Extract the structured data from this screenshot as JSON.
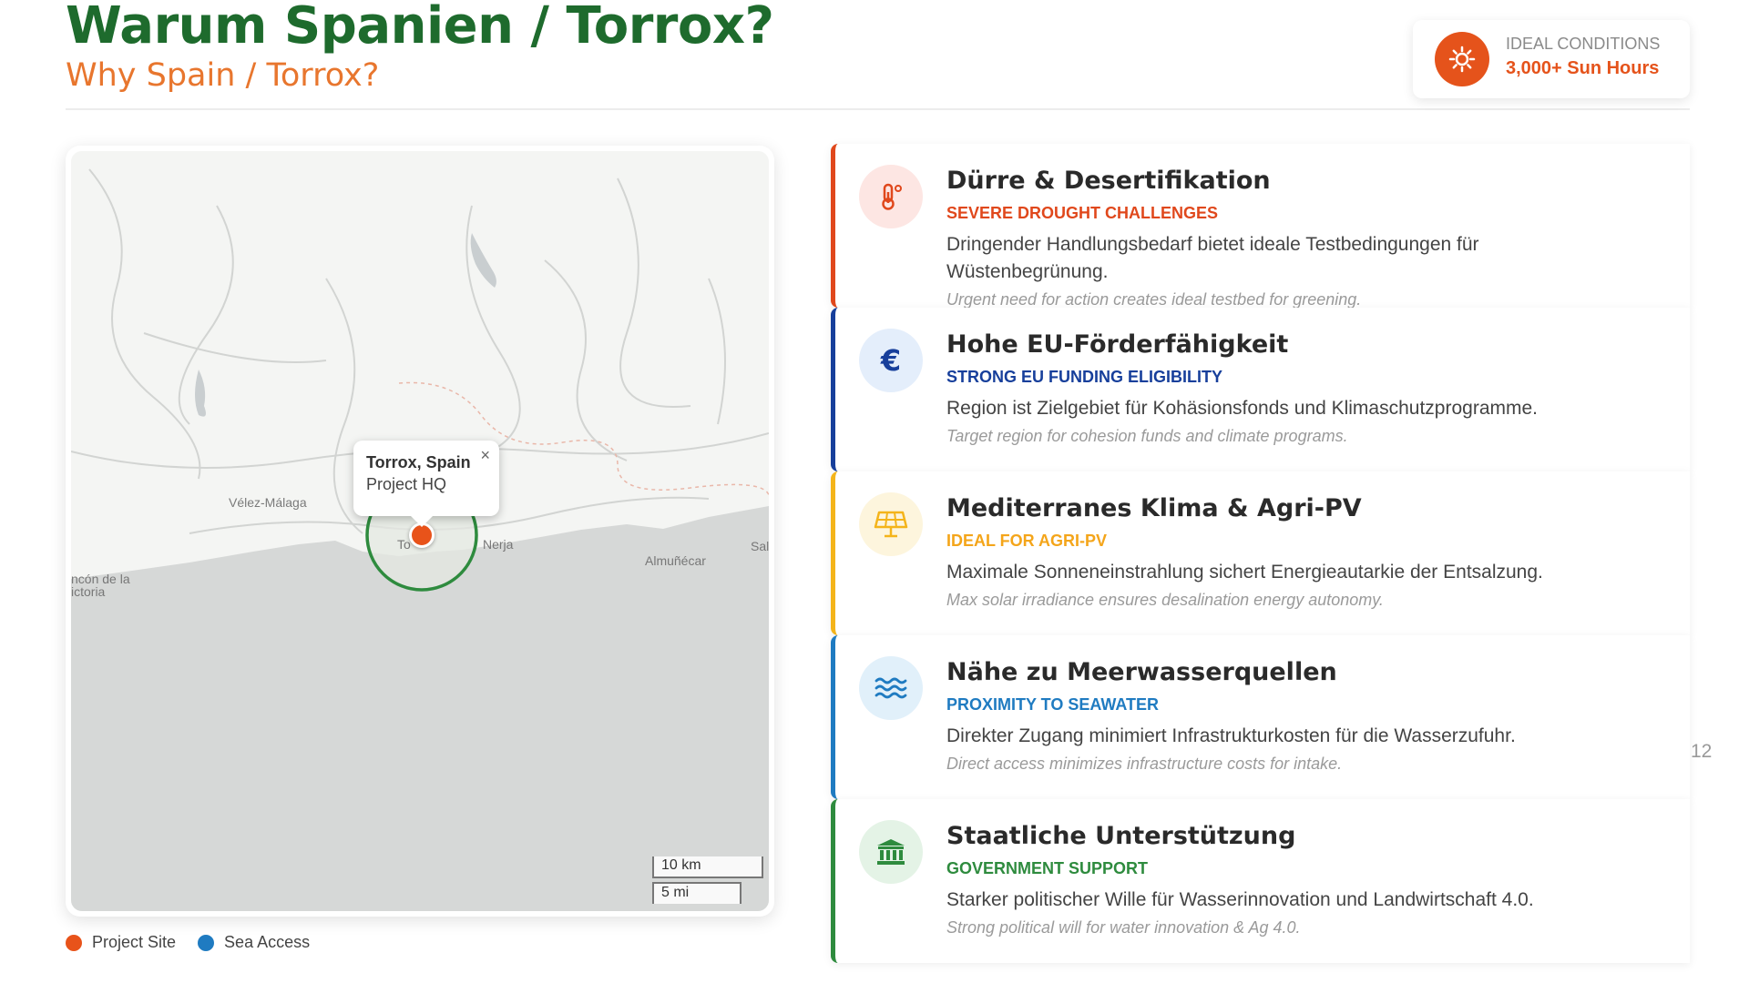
{
  "header": {
    "title": "Warum Spanien / Torrox?",
    "subtitle": "Why Spain / Torrox?"
  },
  "badge": {
    "icon": "sun-icon",
    "label": "IDEAL CONDITIONS",
    "value": "3,000+ Sun Hours"
  },
  "map": {
    "places": {
      "velez": "Vélez-Málaga",
      "nerja": "Nerja",
      "almunecar": "Almuñécar",
      "sal": "Sal",
      "rincon_1": "ncón de la",
      "rincon_2": "ictoria",
      "torrox_partial": "To"
    },
    "popup": {
      "title": "Torrox, Spain",
      "subtitle": "Project HQ",
      "close": "×"
    },
    "scale": {
      "km": "10 km",
      "mi": "5 mi"
    }
  },
  "legend": [
    {
      "label": "Project Site",
      "color": "#e8531a"
    },
    {
      "label": "Sea Access",
      "color": "#1f7bc1"
    }
  ],
  "cards": [
    {
      "title": "Dürre & Desertifikation",
      "subtitle": "SEVERE DROUGHT CHALLENGES",
      "desc": "Dringender Handlungsbedarf bietet ideale Testbedingungen für Wüstenbegrünung.",
      "en": "Urgent need for action creates ideal testbed for greening.",
      "icon": "thermometer-icon",
      "color": "#e0481c",
      "bg": "#fde6e3"
    },
    {
      "title": "Hohe EU-Förderfähigkeit",
      "subtitle": "STRONG EU FUNDING ELIGIBILITY",
      "desc": "Region ist Zielgebiet für Kohäsionsfonds und Klimaschutzprogramme.",
      "en": "Target region for cohesion funds and climate programs.",
      "icon": "euro-icon",
      "color": "#173f9b",
      "bg": "#e4eefb"
    },
    {
      "title": "Mediterranes Klima & Agri-PV",
      "subtitle": "IDEAL FOR AGRI-PV",
      "desc": "Maximale Sonneneinstrahlung sichert Energieautarkie der Entsalzung.",
      "en": "Max solar irradiance ensures desalination energy autonomy.",
      "icon": "solar-panel-icon",
      "color": "#f4b41a",
      "bg": "#fdf5dd"
    },
    {
      "title": "Nähe zu Meerwasserquellen",
      "subtitle": "PROXIMITY TO SEAWATER",
      "desc": "Direkter Zugang minimiert Infrastrukturkosten für die Wasserzufuhr.",
      "en": "Direct access minimizes infrastructure costs for intake.",
      "icon": "water-waves-icon",
      "color": "#1f7bc1",
      "bg": "#e1f0fa"
    },
    {
      "title": "Staatliche Unterstützung",
      "subtitle": "GOVERNMENT SUPPORT",
      "desc": "Starker politischer Wille für Wasserinnovation und Landwirtschaft 4.0.",
      "en": "Strong political will for water innovation & Ag 4.0.",
      "icon": "government-building-icon",
      "color": "#2e8b3e",
      "bg": "#e4f3e6"
    }
  ],
  "page_number": "12"
}
